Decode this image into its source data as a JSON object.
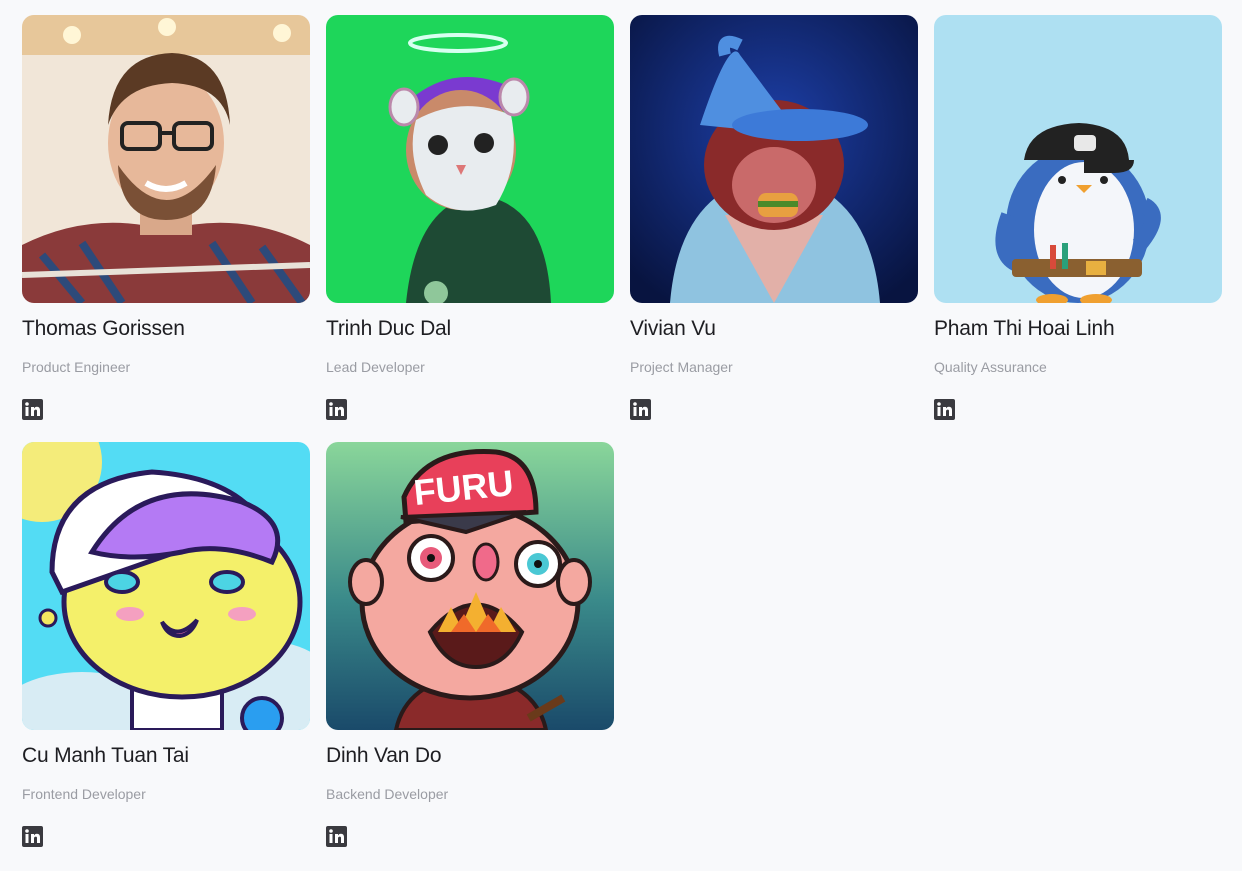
{
  "team": [
    {
      "name": "Thomas Gorissen",
      "role": "Product Engineer",
      "avatar_icon": "person-photo-icon",
      "social_icon": "linkedin-icon"
    },
    {
      "name": "Trinh Duc Dal",
      "role": "Lead Developer",
      "avatar_icon": "masked-rat-nft-icon",
      "social_icon": "linkedin-icon"
    },
    {
      "name": "Vivian Vu",
      "role": "Project Manager",
      "avatar_icon": "wizard-ape-nft-icon",
      "social_icon": "linkedin-icon"
    },
    {
      "name": "Pham Thi Hoai Linh",
      "role": "Quality Assurance",
      "avatar_icon": "penguin-nft-icon",
      "social_icon": "linkedin-icon"
    },
    {
      "name": "Cu Manh Tuan Tai",
      "role": "Frontend Developer",
      "avatar_icon": "cartoon-kid-nft-icon",
      "social_icon": "linkedin-icon"
    },
    {
      "name": "Dinh Van Do",
      "role": "Backend Developer",
      "avatar_icon": "furu-character-nft-icon",
      "social_icon": "linkedin-icon",
      "cap_text": "FURU"
    }
  ],
  "colors": {
    "background": "#f8f9fb",
    "name_text": "#1e1e22",
    "role_text": "#9a9ca3",
    "linkedin_icon": "#3a3a3f"
  }
}
